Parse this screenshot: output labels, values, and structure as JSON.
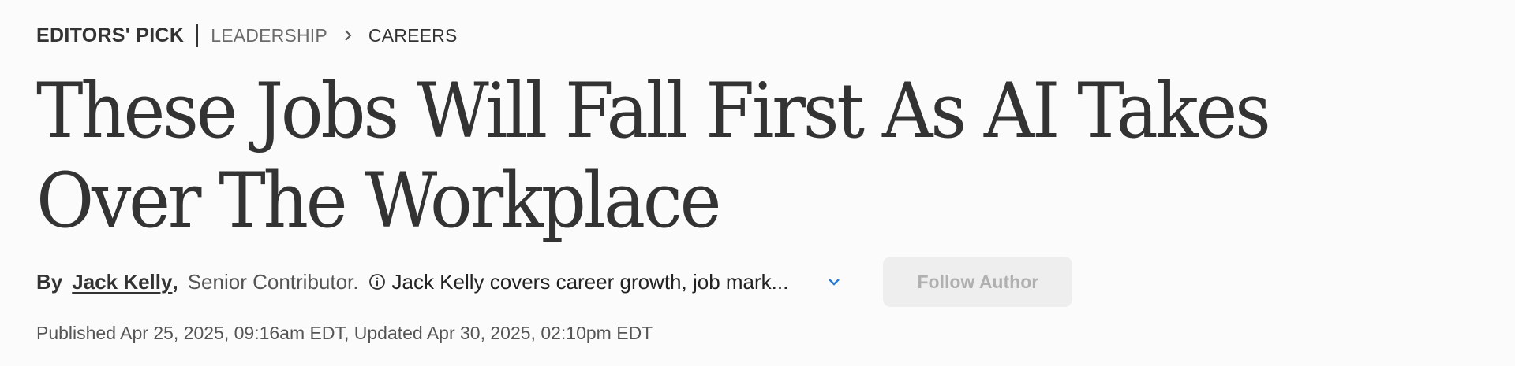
{
  "breadcrumb": {
    "pick_label": "EDITORS' PICK",
    "section": "LEADERSHIP",
    "subsection": "CAREERS"
  },
  "article": {
    "headline": "These Jobs Will Fall First As AI Takes Over The Workplace"
  },
  "byline": {
    "by": "By",
    "author": "Jack Kelly",
    "comma": ",",
    "author_title": "Senior Contributor.",
    "bio_snippet": "Jack Kelly covers career growth, job mark...",
    "follow_label": "Follow Author"
  },
  "dates": {
    "text": "Published Apr 25, 2025, 09:16am EDT, Updated Apr 30, 2025, 02:10pm EDT"
  },
  "colors": {
    "text": "#333333",
    "muted": "#6b6b6b",
    "accent": "#2a7bd4",
    "button_bg": "#eeeeee",
    "button_text": "#b0b0b0"
  },
  "icons": {
    "breadcrumb_separator": "chevron-right-icon",
    "bio_info": "info-icon",
    "bio_expand": "chevron-down-icon"
  }
}
